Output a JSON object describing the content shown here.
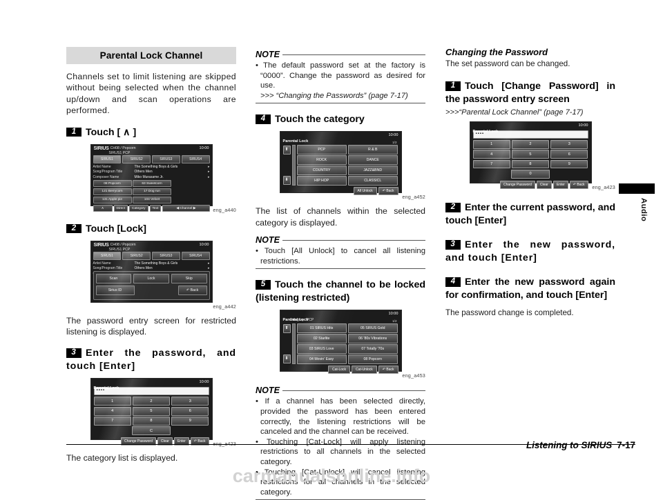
{
  "section": {
    "banner": "Parental Lock Channel",
    "intro": "Channels set to limit listening are skipped without being selected when the channel up/down and scan operations are performed."
  },
  "steps": {
    "s1": {
      "num": "1",
      "text": "Touch [  ]",
      "label": "Touch [",
      "arrow": "∧",
      "close": "]"
    },
    "s2": {
      "num": "2",
      "text": "Touch [Lock]"
    },
    "s3": {
      "num": "3",
      "text": "Enter the password, and touch [Enter]"
    },
    "s4": {
      "num": "4",
      "text": "Touch the category"
    },
    "s5": {
      "num": "5",
      "text": "Touch the channel to be locked (listening restricted)"
    },
    "r1": {
      "num": "1",
      "text": "Touch [Change Password] in the password entry screen"
    },
    "r2": {
      "num": "2",
      "text": "Enter the current password, and touch [Enter]"
    },
    "r3": {
      "num": "3",
      "text": "Enter the new password, and touch [Enter]"
    },
    "r4": {
      "num": "4",
      "text": "Enter the new password again for confirmation, and touch [Enter]"
    }
  },
  "paragraphs": {
    "after_lock": "The password entry screen for restricted listening is displayed.",
    "after_password": "The category list is displayed.",
    "after_category": "The list of channels within the selected category is displayed.",
    "password_done": "The password change is completed.",
    "change_intro": "The set password can be changed."
  },
  "notes": {
    "label": "NOTE",
    "note1_line1": "The default password set at the factory is “0000”. Change the password as desired for use.",
    "note1_ref": ">>> “Changing the Passwords” (page 7-17)",
    "note2": "Touch [All Unlock] to cancel all listening restrictions.",
    "note3_b1": "If a channel has been selected directly, provided the password has been entered correctly, the listening restrictions will be canceled and the channel can be received.",
    "note3_b2": "Touching [Cat-Lock] will apply listening restrictions to all channels in the selected category.",
    "note3_b3": "Touching [Cat-Unlock] will cancel listening restrictions for all channels in the selected category."
  },
  "right_section": {
    "heading": "Changing the Password",
    "ref": ">>>“Parental Lock Channel” (page 7-17)"
  },
  "captions": {
    "a440": "eng_a440",
    "a442": "eng_a442",
    "a423a": "eng_a423",
    "a452": "eng_a452",
    "a453": "eng_a453",
    "a423b": "eng_a423"
  },
  "radio_screen": {
    "logo": "SIRIUS",
    "channel_info": "CH08 / Popcorn",
    "sub": "SIRUS1    PCP",
    "clock": "10:00",
    "presets": [
      "SIRUS1",
      "SIRUS2",
      "SIRUS3",
      "SIRUS4"
    ],
    "meta": [
      {
        "label": "Artist  Name",
        "value": "The Something Boys & Girls"
      },
      {
        "label": "Song/Program  Title",
        "value": "Others Men"
      },
      {
        "label": "Composer  Name",
        "value": "Miko Murasame Jr."
      }
    ],
    "channels": [
      "08 Popcorn",
      "63 Sweetcorn",
      "121 Berrycorn",
      "17 Dog run",
      "131 Apple pie",
      "104 Velvet"
    ],
    "bottom_buttons": [
      "∧",
      "Direct",
      "Category",
      "Text",
      "Channel"
    ],
    "channel_prev": "◀",
    "channel_next": "▶",
    "overlay_buttons": [
      "Scan",
      "Lock",
      "Skip"
    ],
    "overlay_sirius_id": "Sirius ID",
    "overlay_back": "Back"
  },
  "keypad_screen": {
    "title": "Parental Lock",
    "clock": "10:00",
    "entry": "▪▪▪▪",
    "keys_left": [
      "1",
      "2",
      "3",
      "4",
      "5",
      "6",
      "7",
      "8",
      "9",
      "C"
    ],
    "keys_right": [
      "1",
      "2",
      "3",
      "4",
      "5",
      "6",
      "7",
      "8",
      "9",
      "0"
    ],
    "footer": [
      "Change Password",
      "Clear",
      "Enter",
      "Back"
    ]
  },
  "category_screen": {
    "title": "Parental Lock",
    "clock": "10:00",
    "page": "1/2",
    "items": [
      "PCP",
      "R & B",
      "ROCK",
      "DANCE",
      "COUNTRY",
      "JAZZ&BND",
      "HIP HOP",
      "CLASSICL"
    ],
    "footer": [
      "All Unlock",
      "Back"
    ],
    "scroll_up": "⬆",
    "scroll_down": "⬇"
  },
  "channel_screen": {
    "title": "Parental Lock",
    "clock": "10:00",
    "page": "1/2",
    "category_line": "Category : PCP",
    "items": [
      "01 SIRUS Hits",
      "05 SIRUS Gold",
      "02 Starlite",
      "06 '80s Vibrations",
      "03 SIRUS Love",
      "07 Totally '70s",
      "04 Movin' Easy",
      "08 Popcorn"
    ],
    "footer": [
      "Cat-Lock",
      "Cat-Unlock",
      "Back"
    ],
    "scroll_up": "⬆",
    "scroll_down": "⬇"
  },
  "footer": {
    "title": "Listening to SIRIUS",
    "page": "7-17",
    "tab": "Audio",
    "watermark": "carmanualsonline.info"
  }
}
